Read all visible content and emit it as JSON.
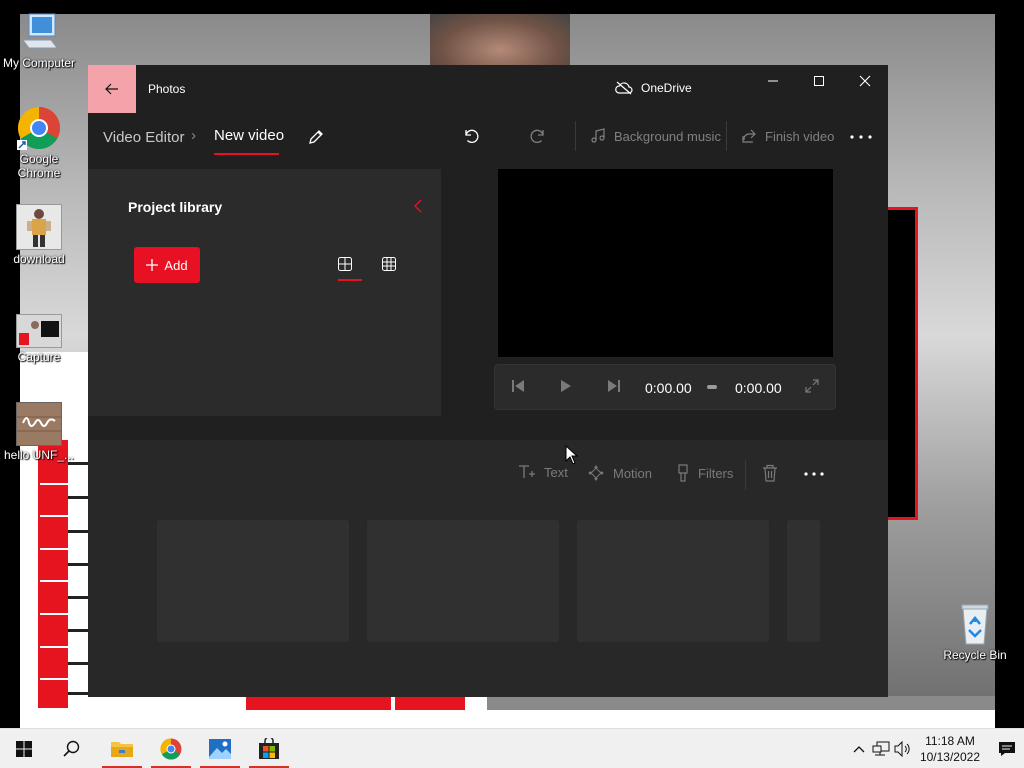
{
  "desktop": {
    "icons": [
      {
        "label": "My Computer"
      },
      {
        "label": "Google Chrome"
      },
      {
        "label": "download"
      },
      {
        "label": "Capture"
      },
      {
        "label": "hello UNF_..."
      },
      {
        "label": "Recycle Bin"
      }
    ]
  },
  "window": {
    "app_title": "Photos",
    "onedrive_label": "OneDrive",
    "breadcrumb": {
      "parent": "Video Editor",
      "separator": "›",
      "current": "New video"
    },
    "commands": {
      "background_music": "Background music",
      "finish_video": "Finish video"
    },
    "library": {
      "title": "Project library",
      "add_label": "Add"
    },
    "player": {
      "current_time": "0:00.00",
      "total_time": "0:00.00"
    },
    "storyboard_tools": {
      "text": "Text",
      "motion": "Motion",
      "filters": "Filters"
    }
  },
  "taskbar": {
    "time": "11:18 AM",
    "date": "10/13/2022"
  },
  "colors": {
    "accent": "#e81123",
    "window_bg": "#202020",
    "pane_bg": "#2b2b2b",
    "back_button": "#f3a3a9"
  }
}
